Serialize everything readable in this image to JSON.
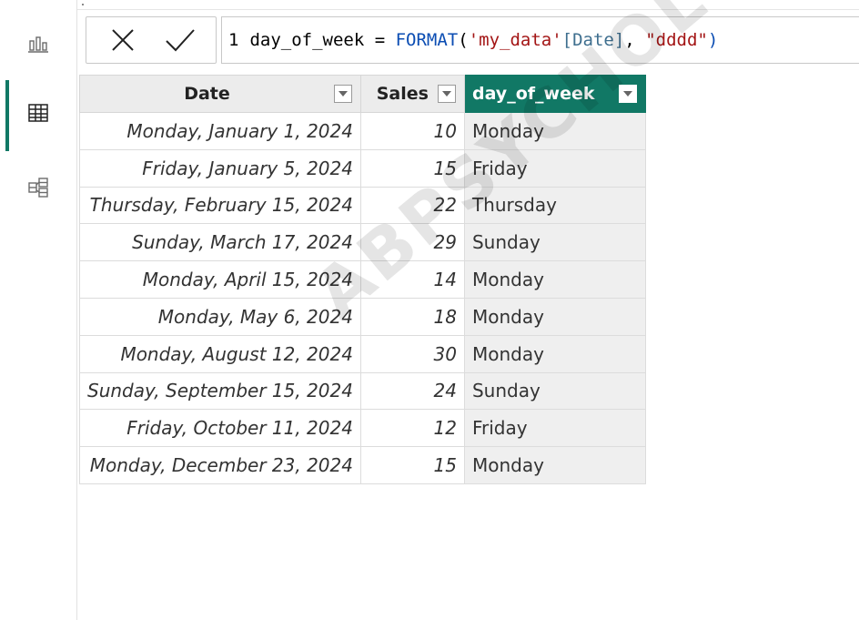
{
  "sidebar": {
    "items": [
      {
        "icon": "report-view-icon",
        "active": false
      },
      {
        "icon": "table-view-icon",
        "active": true
      },
      {
        "icon": "model-view-icon",
        "active": false
      }
    ],
    "accent_color": "#117865"
  },
  "formula_bar": {
    "cancel_icon": "close-icon",
    "commit_icon": "checkmark-icon",
    "line_number": "1",
    "tokens": {
      "t1": "day_of_week = ",
      "t2": "FORMAT",
      "t3": "(",
      "t4": "'my_data'",
      "t5": "[Date]",
      "t6": ", ",
      "t7": "\"dddd\"",
      "t8": ")"
    }
  },
  "table": {
    "columns": [
      {
        "label": "Date",
        "active": false
      },
      {
        "label": "Sales",
        "active": false
      },
      {
        "label": "day_of_week",
        "active": true
      }
    ],
    "rows": [
      {
        "date": "Monday, January 1, 2024",
        "sales": "10",
        "dow": "Monday"
      },
      {
        "date": "Friday, January 5, 2024",
        "sales": "15",
        "dow": "Friday"
      },
      {
        "date": "Thursday, February 15, 2024",
        "sales": "22",
        "dow": "Thursday"
      },
      {
        "date": "Sunday, March 17, 2024",
        "sales": "29",
        "dow": "Sunday"
      },
      {
        "date": "Monday, April 15, 2024",
        "sales": "14",
        "dow": "Monday"
      },
      {
        "date": "Monday, May 6, 2024",
        "sales": "18",
        "dow": "Monday"
      },
      {
        "date": "Monday, August 12, 2024",
        "sales": "30",
        "dow": "Monday"
      },
      {
        "date": "Sunday, September 15, 2024",
        "sales": "24",
        "dow": "Sunday"
      },
      {
        "date": "Friday, October 11, 2024",
        "sales": "12",
        "dow": "Friday"
      },
      {
        "date": "Monday, December 23, 2024",
        "sales": "15",
        "dow": "Monday"
      }
    ]
  },
  "watermark": "ABPSYCHOLOGY"
}
